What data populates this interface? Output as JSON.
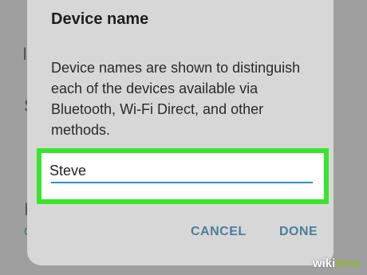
{
  "dialog": {
    "title": "Device name",
    "message": "Device names are shown to distinguish each of the devices available via Bluetooth, Wi-Fi Direct, and other methods.",
    "input_value": "Steve",
    "cancel_label": "CANCEL",
    "done_label": "DONE"
  },
  "watermark": {
    "prefix": "wiki",
    "suffix": "How"
  },
  "colors": {
    "highlight": "#39e52c",
    "accent": "#4a7f99",
    "underline": "#2f8fcf"
  }
}
